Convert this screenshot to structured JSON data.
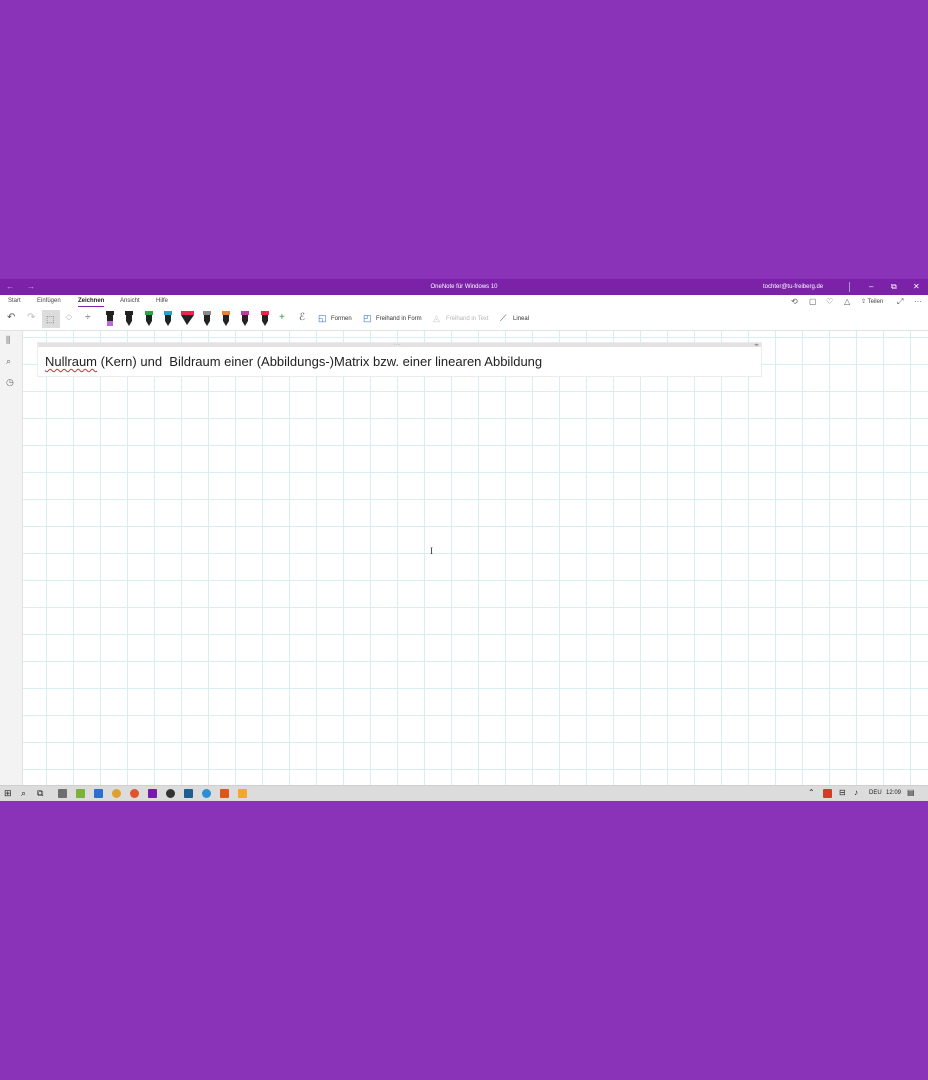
{
  "window": {
    "title": "OneNote für Windows 10",
    "account": "tochter@tu-freiberg.de",
    "back_icon": "←",
    "forward_icon": "→",
    "minimize_icon": "–",
    "maximize_icon": "⧉",
    "close_icon": "✕"
  },
  "menu": {
    "tabs": [
      "Start",
      "Einfügen",
      "Zeichnen",
      "Ansicht",
      "Hilfe"
    ],
    "active_tab": "Zeichnen",
    "share_label": "Teilen",
    "more_label": "···"
  },
  "toolbar": {
    "undo_icon": "↶",
    "redo_icon": "↷",
    "add_pen_icon": "+",
    "formen_label": "Formen",
    "freihand_in_form_label": "Freihand in Form",
    "freihand_in_text_label": "Freihand in Text",
    "lineal_label": "Lineal",
    "pen_colors": [
      "#222222",
      "#27a844",
      "#2aa0d8",
      "#ff2e5b",
      "#8a8a8a",
      "#f0802a",
      "#c03c9c",
      "#e8264f"
    ],
    "highlighter_colors": [
      "#b86bd6",
      "#e8264f"
    ]
  },
  "note": {
    "title_misspelled": "Nullraum",
    "title_rest": " (Kern) und  Bildraum einer (Abbildungs-)Matrix bzw. einer linearen Abbildung",
    "grip": "····",
    "expand": "◂▸"
  },
  "cursor_glyph": "I",
  "taskbar": {
    "language": "DEU",
    "time": "12:09",
    "app_colors": [
      "#6e6e6e",
      "#7ab23a",
      "#2d6fc9",
      "#e0a030",
      "#3cab4a",
      "#e0532b",
      "#7719aa",
      "#333333",
      "#1f5f8f",
      "#2c8ed6",
      "#d85a1a",
      "#f0a830"
    ]
  }
}
